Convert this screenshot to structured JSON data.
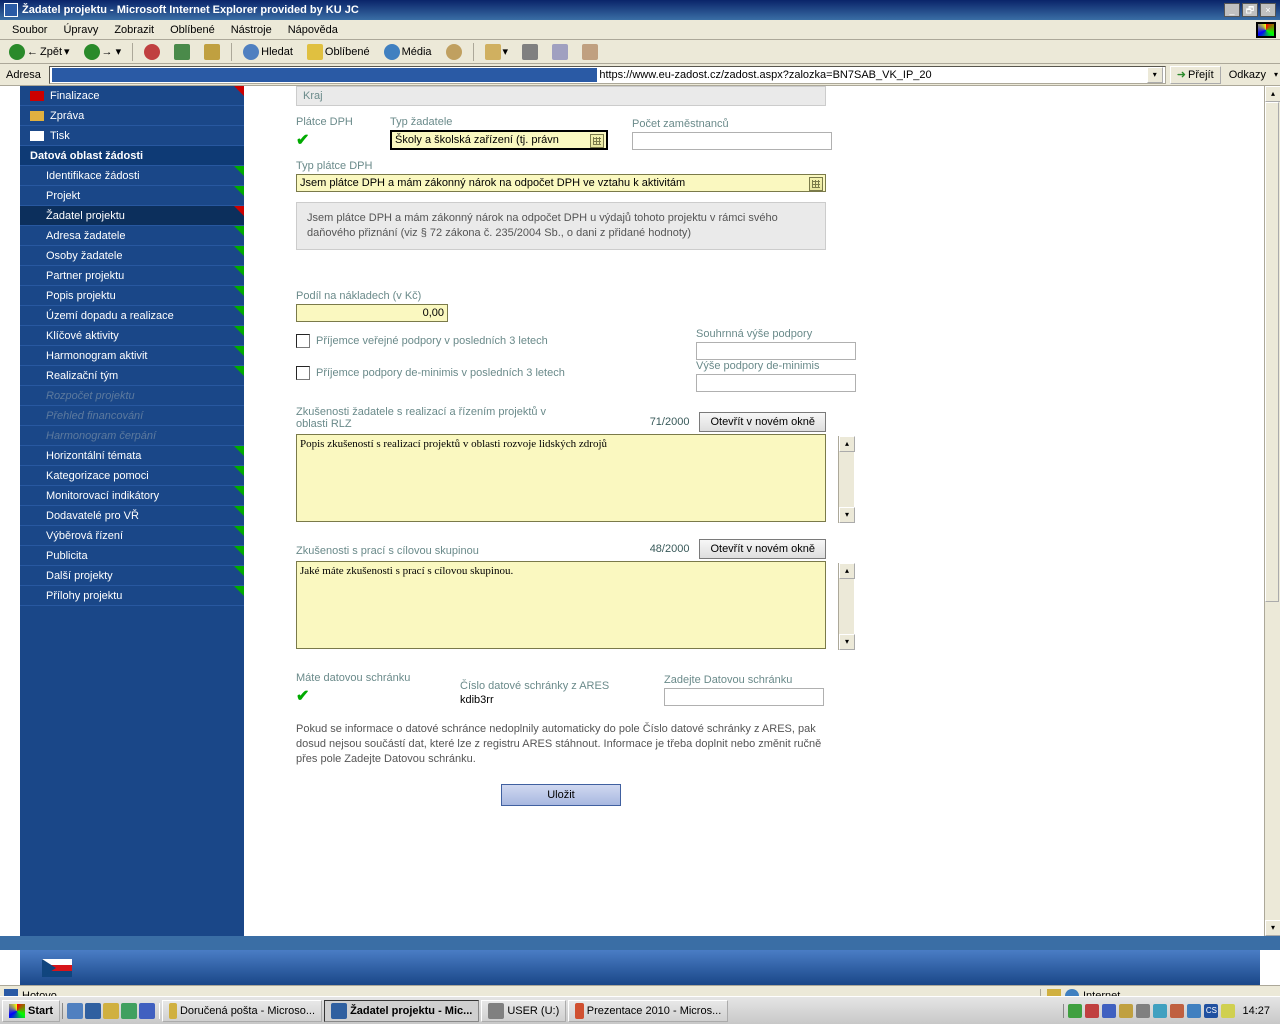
{
  "window": {
    "title": "Žadatel projektu - Microsoft Internet Explorer provided by KU JC"
  },
  "menubar": [
    "Soubor",
    "Úpravy",
    "Zobrazit",
    "Oblíbené",
    "Nástroje",
    "Nápověda"
  ],
  "toolbar": {
    "back": "Zpět",
    "search": "Hledat",
    "favorites": "Oblíbené",
    "media": "Média"
  },
  "address": {
    "label": "Adresa",
    "url": "https://www.eu-zadost.cz/zadost.aspx?zalozka=BN7SAB_VK_IP_20",
    "go": "Přejít",
    "links": "Odkazy"
  },
  "sidebar": {
    "top": [
      {
        "label": "Finalizace",
        "icon": "red"
      },
      {
        "label": "Zpráva",
        "icon": "folder"
      },
      {
        "label": "Tisk",
        "icon": "doc"
      }
    ],
    "section": "Datová oblast žádosti",
    "items": [
      {
        "label": "Identifikace žádosti"
      },
      {
        "label": "Projekt"
      },
      {
        "label": "Žadatel projektu",
        "active": true
      },
      {
        "label": "Adresa žadatele"
      },
      {
        "label": "Osoby žadatele"
      },
      {
        "label": "Partner projektu"
      },
      {
        "label": "Popis projektu"
      },
      {
        "label": "Území dopadu a realizace"
      },
      {
        "label": "Klíčové aktivity"
      },
      {
        "label": "Harmonogram aktivit"
      },
      {
        "label": "Realizační tým"
      },
      {
        "label": "Rozpočet projektu",
        "disabled": true
      },
      {
        "label": "Přehled financování",
        "disabled": true
      },
      {
        "label": "Harmonogram čerpání",
        "disabled": true
      },
      {
        "label": "Horizontální témata"
      },
      {
        "label": "Kategorizace pomoci"
      },
      {
        "label": "Monitorovací indikátory"
      },
      {
        "label": "Dodavatelé pro VŘ"
      },
      {
        "label": "Výběrová řízení"
      },
      {
        "label": "Publicita"
      },
      {
        "label": "Další projekty"
      },
      {
        "label": "Přílohy projektu"
      }
    ]
  },
  "form": {
    "kraj": "Kraj",
    "platceDPH": "Plátce DPH",
    "typZadatele": {
      "label": "Typ žadatele",
      "value": "Školy a školská zařízení (tj. právn"
    },
    "pocetZam": "Počet zaměstnanců",
    "typPlatce": {
      "label": "Typ plátce DPH",
      "value": "Jsem plátce DPH a mám zákonný nárok na odpočet DPH ve vztahu k aktivitám"
    },
    "dphInfo": "Jsem plátce DPH a mám zákonný nárok na odpočet DPH u výdajů tohoto projektu v rámci svého daňového přiznání (viz § 72 zákona č. 235/2004 Sb., o dani z přidané hodnoty)",
    "podil": {
      "label": "Podíl na nákladech (v Kč)",
      "value": "0,00"
    },
    "chk1": "Příjemce veřejné podpory v posledních 3 letech",
    "chk2": "Příjemce podpory de-minimis v posledních 3 letech",
    "souhrnna": "Souhrnná výše podpory",
    "vyse": "Výše podpory de-minimis",
    "zkus1": {
      "label": "Zkušenosti žadatele s realizací a řízením projektů v oblasti RLZ",
      "counter": "71/2000",
      "btn": "Otevřít v novém okně",
      "value": "Popis zkušeností s realizací projektů v oblasti rozvoje lidských zdrojů"
    },
    "zkus2": {
      "label": "Zkušenosti s prací s cílovou skupinou",
      "counter": "48/2000",
      "btn": "Otevřít v novém okně",
      "value": "Jaké máte zkušenosti s prací s cílovou skupinou."
    },
    "ds1": "Máte datovou schránku",
    "ds2": {
      "label": "Číslo datové schránky z ARES",
      "value": "kdib3rr"
    },
    "ds3": "Zadejte Datovou schránku",
    "aresInfo": "Pokud se informace o datové schránce nedoplnily automaticky do pole Číslo datové schránky z ARES, pak dosud nejsou součástí dat, které lze z registru ARES stáhnout. Informace je třeba doplnit nebo změnit ručně přes pole Zadejte Datovou schránku.",
    "save": "Uložit"
  },
  "status": {
    "left": "Hotovo",
    "right": "Internet"
  },
  "taskbar": {
    "start": "Start",
    "tasks": [
      {
        "label": "Doručená pošta - Microso..."
      },
      {
        "label": "Žadatel projektu - Mic...",
        "active": true
      },
      {
        "label": "USER (U:)"
      },
      {
        "label": "Prezentace 2010 - Micros..."
      }
    ],
    "clock": "14:27"
  }
}
